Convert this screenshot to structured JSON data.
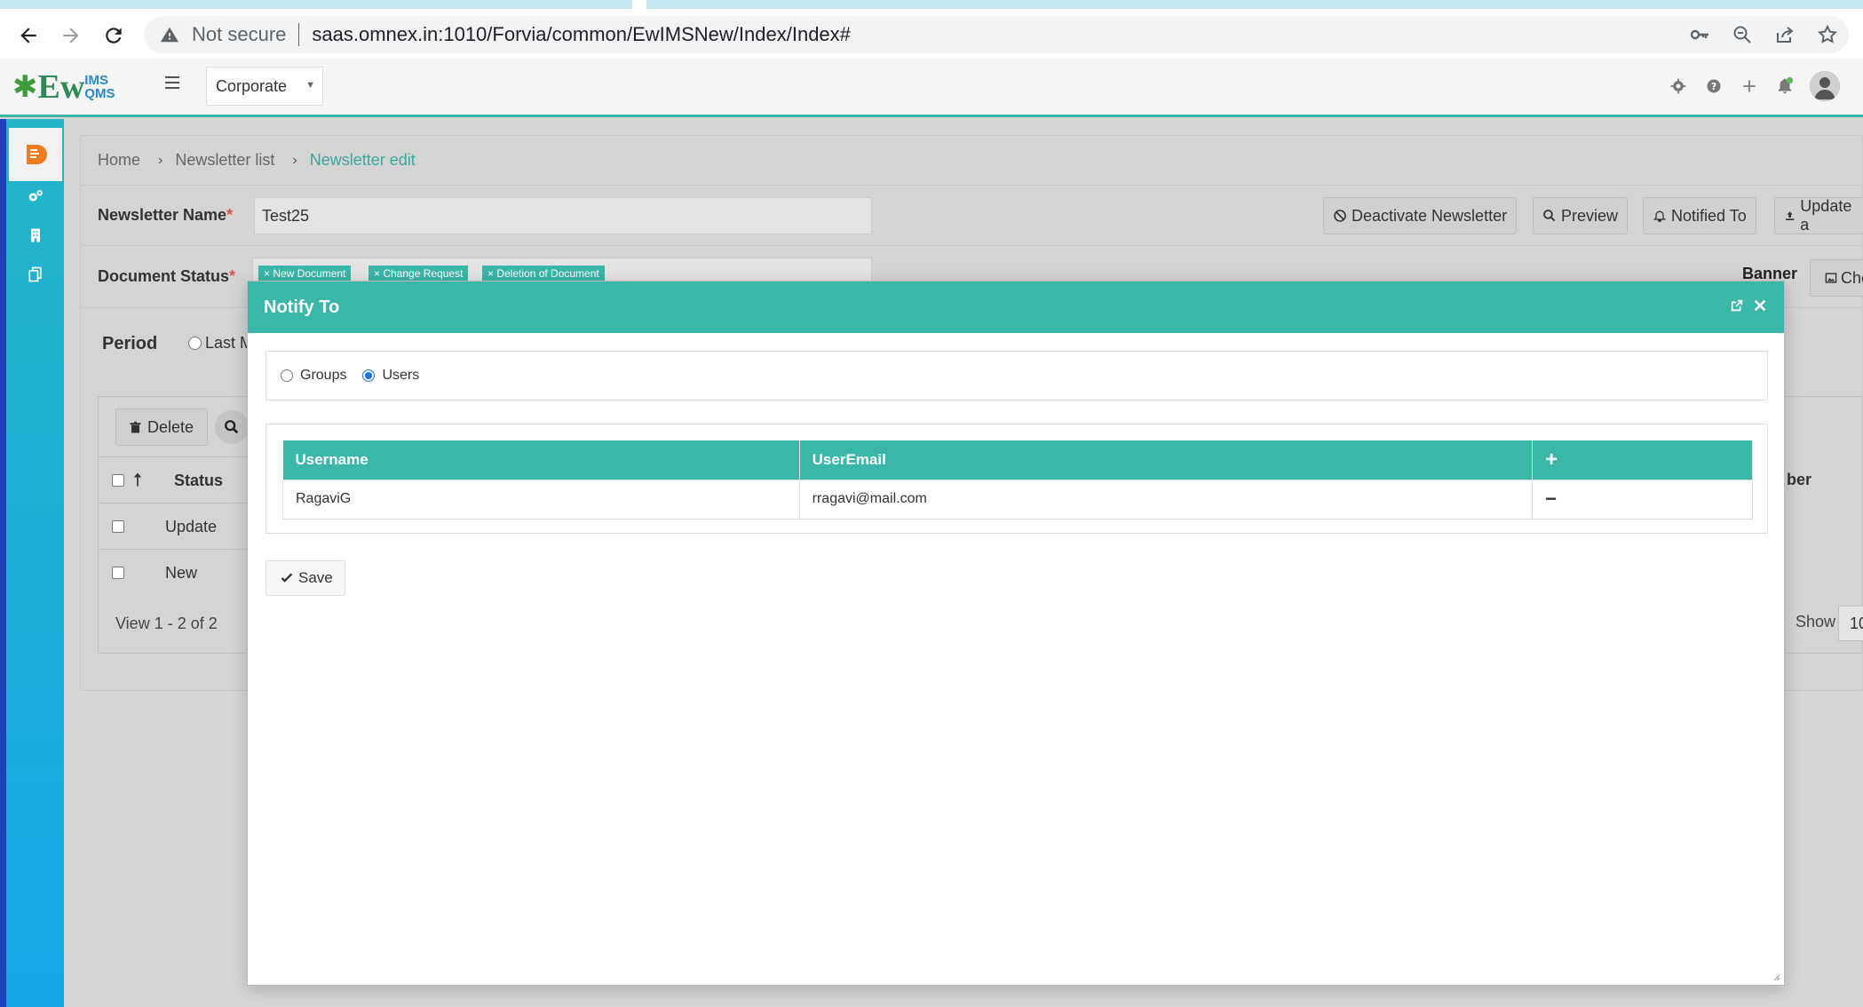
{
  "browser": {
    "security_label": "Not secure",
    "url": "saas.omnex.in:1010/Forvia/common/EwIMSNew/Index/Index#"
  },
  "header": {
    "logo_main": "Ew",
    "logo_top": "IMS",
    "logo_bottom": "QMS",
    "corporate_select": "Corporate"
  },
  "breadcrumb": {
    "home": "Home",
    "list": "Newsletter list",
    "current": "Newsletter edit"
  },
  "form": {
    "name_label": "Newsletter Name",
    "name_value": "Test25",
    "status_label": "Document Status",
    "status_tags": [
      "× New Document",
      "× Change Request",
      "× Deletion of Document"
    ],
    "banner_label": "Banner",
    "choose_label": "Cho",
    "period_label": "Period",
    "period_option": "Last M",
    "required_mark": "*"
  },
  "toolbar": {
    "deactivate": "Deactivate Newsletter",
    "preview": "Preview",
    "notified_to": "Notified To",
    "update": "Update a"
  },
  "grid": {
    "delete_label": "Delete",
    "status_header": "Status",
    "partial_header": "ber",
    "rows": [
      "Update",
      "New"
    ],
    "view_text": "View 1 - 2 of 2",
    "show_label": "Show",
    "show_value": "10"
  },
  "modal": {
    "title": "Notify To",
    "radio_groups": "Groups",
    "radio_users": "Users",
    "col_username": "Username",
    "col_email": "UserEmail",
    "add_symbol": "+",
    "remove_symbol": "−",
    "rows": [
      {
        "username": "RagaviG",
        "email": "rragavi@mail.com"
      }
    ],
    "save_label": "Save"
  },
  "colors": {
    "accent": "#3ab7a9",
    "sidebar_top": "#23b5c5",
    "sidebar_bottom": "#14a8e8",
    "radio_checked": "#1a73e8"
  }
}
